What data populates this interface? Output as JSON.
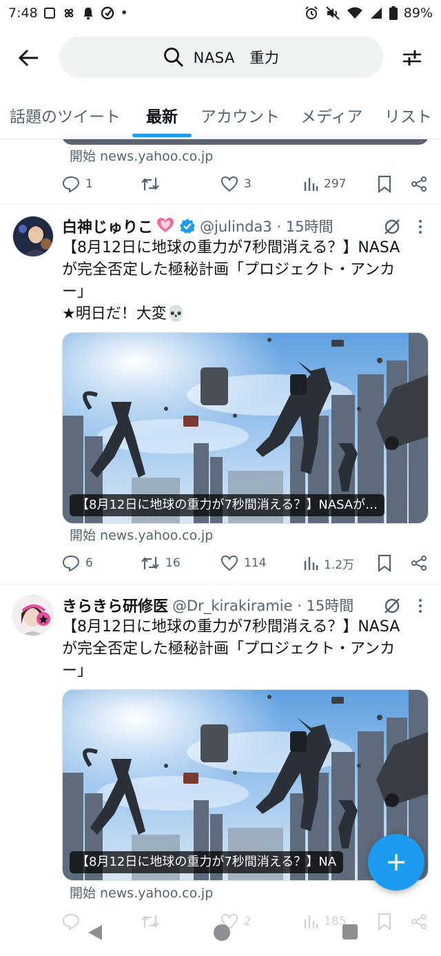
{
  "status_bar": {
    "time": "7:48",
    "dot": "•",
    "battery_percent": "89%",
    "icons": [
      "screen-icon",
      "pinwheel-icon",
      "bell-icon",
      "sync-icon",
      "alarm-icon",
      "mute-icon",
      "wifi-icon",
      "signal-icon",
      "battery-icon"
    ]
  },
  "header": {
    "search_text": "NASA　重力",
    "tabs": [
      {
        "label": "話題のツイート",
        "active": false
      },
      {
        "label": "最新",
        "active": true
      },
      {
        "label": "アカウント",
        "active": false
      },
      {
        "label": "メディア",
        "active": false
      },
      {
        "label": "リスト",
        "active": false
      }
    ]
  },
  "tweets": [
    {
      "partial": true,
      "card_source": "開始 news.yahoo.co.jp",
      "replies": "1",
      "retweets": "",
      "likes": "3",
      "views": "297"
    },
    {
      "display_name": "白神じゅりこ",
      "name_emoji": "💓",
      "verified": true,
      "handle_time": "@julinda3 · 15時間",
      "text_lines": [
        "【8月12日に地球の重力が7秒間消える？】NASA",
        "が完全否定した極秘計画「プロジェクト・アンカ",
        "ー」",
        "★明日だ！大変💀"
      ],
      "image_caption": "【8月12日に地球の重力が7秒間消える？】NASAが…",
      "card_source": "開始 news.yahoo.co.jp",
      "replies": "6",
      "retweets": "16",
      "likes": "114",
      "views": "1.2万"
    },
    {
      "display_name": "きらきら研修医",
      "verified": false,
      "handle_time": "@Dr_kirakiramie · 15時間",
      "text_lines": [
        "【8月12日に地球の重力が7秒間消える？】NASA",
        "が完全否定した極秘計画「プロジェクト・アンカ",
        "ー」"
      ],
      "image_caption": "【8月12日に地球の重力が7秒間消える？】NA",
      "card_source": "開始 news.yahoo.co.jp",
      "replies": "",
      "retweets": "",
      "likes": "2",
      "views": "185"
    }
  ],
  "colors": {
    "accent": "#1d9bf0",
    "text_primary": "#0f1419",
    "text_secondary": "#536471"
  }
}
